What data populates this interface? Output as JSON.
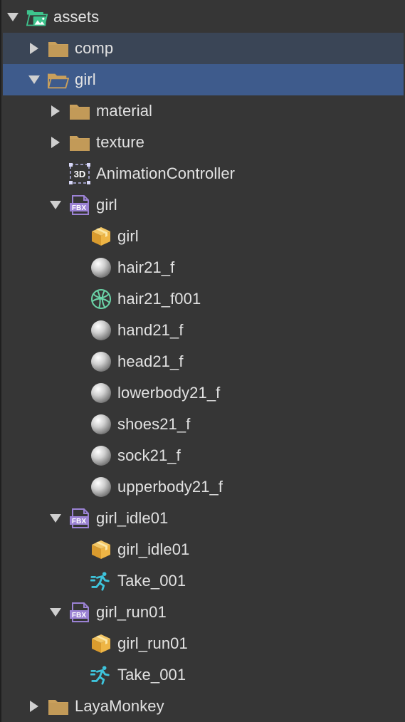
{
  "tree": {
    "rows": [
      {
        "label": "assets",
        "icon": "assets-folder-icon",
        "expander": "expanded",
        "indent": 0
      },
      {
        "label": "comp",
        "icon": "folder-icon",
        "expander": "collapsed",
        "indent": 1,
        "state": "hover"
      },
      {
        "label": "girl",
        "icon": "open-folder-icon",
        "expander": "expanded",
        "indent": 1,
        "state": "selected"
      },
      {
        "label": "material",
        "icon": "folder-icon",
        "expander": "collapsed",
        "indent": 2
      },
      {
        "label": "texture",
        "icon": "folder-icon",
        "expander": "collapsed",
        "indent": 2
      },
      {
        "label": "AnimationController",
        "icon": "animation-controller-3d-icon",
        "expander": "none",
        "indent": 2
      },
      {
        "label": "girl",
        "icon": "fbx-file-icon",
        "expander": "expanded",
        "indent": 2
      },
      {
        "label": "girl",
        "icon": "prefab-box-icon",
        "expander": "none",
        "indent": 3
      },
      {
        "label": "hair21_f",
        "icon": "material-sphere-icon",
        "expander": "none",
        "indent": 3
      },
      {
        "label": "hair21_f001",
        "icon": "mesh-sphere-icon",
        "expander": "none",
        "indent": 3
      },
      {
        "label": "hand21_f",
        "icon": "material-sphere-icon",
        "expander": "none",
        "indent": 3
      },
      {
        "label": "head21_f",
        "icon": "material-sphere-icon",
        "expander": "none",
        "indent": 3
      },
      {
        "label": "lowerbody21_f",
        "icon": "material-sphere-icon",
        "expander": "none",
        "indent": 3
      },
      {
        "label": "shoes21_f",
        "icon": "material-sphere-icon",
        "expander": "none",
        "indent": 3
      },
      {
        "label": "sock21_f",
        "icon": "material-sphere-icon",
        "expander": "none",
        "indent": 3
      },
      {
        "label": "upperbody21_f",
        "icon": "material-sphere-icon",
        "expander": "none",
        "indent": 3
      },
      {
        "label": "girl_idle01",
        "icon": "fbx-file-icon",
        "expander": "expanded",
        "indent": 2
      },
      {
        "label": "girl_idle01",
        "icon": "prefab-box-icon",
        "expander": "none",
        "indent": 3
      },
      {
        "label": "Take_001",
        "icon": "animation-clip-running-icon",
        "expander": "none",
        "indent": 3
      },
      {
        "label": "girl_run01",
        "icon": "fbx-file-icon",
        "expander": "expanded",
        "indent": 2
      },
      {
        "label": "girl_run01",
        "icon": "prefab-box-icon",
        "expander": "none",
        "indent": 3
      },
      {
        "label": "Take_001",
        "icon": "animation-clip-running-icon",
        "expander": "none",
        "indent": 3
      },
      {
        "label": "LayaMonkey",
        "icon": "folder-icon",
        "expander": "collapsed",
        "indent": 1
      }
    ]
  },
  "icon_texts": {
    "fbx": "FBX",
    "three_d": "3D"
  },
  "colors": {
    "background": "#363636",
    "selected": "#3e5b8c",
    "hover": "#3a4556",
    "folder": "#c9a05c",
    "assets": "#3ec48d",
    "fbx": "#9b82d4",
    "clip": "#3ec4dc",
    "text": "#e2e2e2"
  }
}
